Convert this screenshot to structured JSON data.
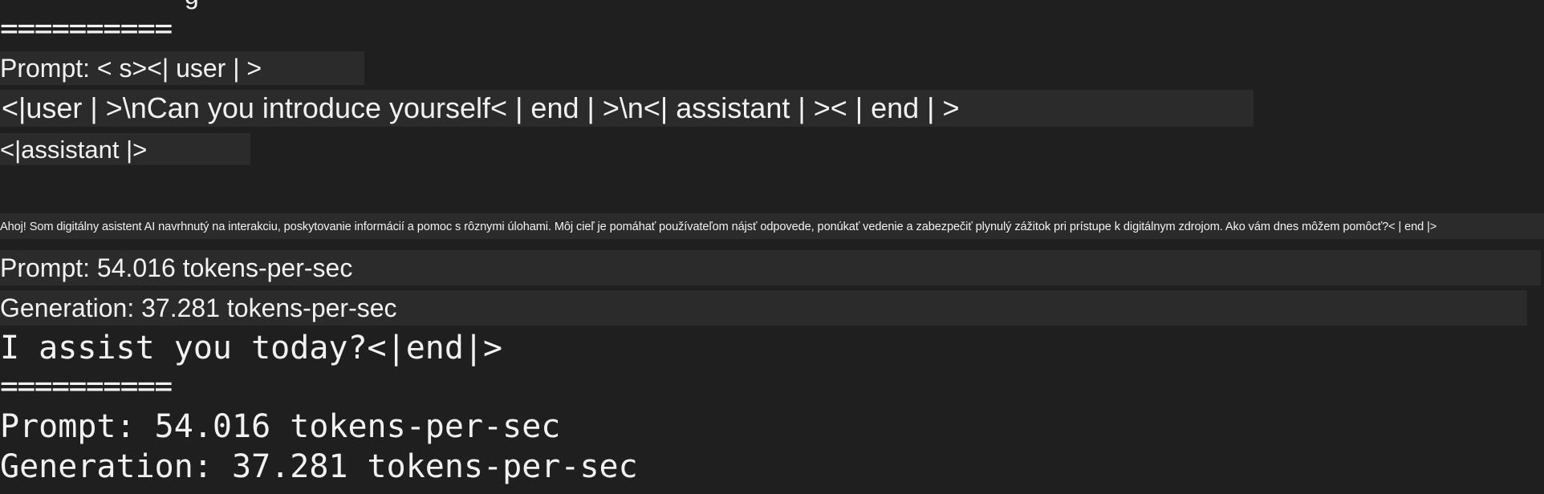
{
  "terminal": {
    "top_partial_text": "g",
    "separator_top": "==========",
    "overlay": {
      "prompt_header": "Prompt: < s><| user | >",
      "prompt_body": "<|user | >\\nCan you introduce yourself< | end | >\\n<| assistant | >< | end | >",
      "assistant_tag": "<|assistant |>",
      "response_sk": "Ahoj! Som digitálny asistent AI navrhnutý na interakciu, poskytovanie informácií a pomoc s rôznymi úlohami. Môj cieľ je pomáhať používateľom nájsť odpovede, ponúkať vedenie a zabezpečiť plynulý zážitok pri prístupe k digitálnym zdrojom. Ako vám dnes môžem pomôcť?< | end |>",
      "prompt_rate": "Prompt: 54.016 tokens-per-sec",
      "generation_rate": "Generation: 37.281 tokens-per-sec"
    },
    "mono_line_reply": "I assist you today?<|end|>",
    "separator_bottom": "==========",
    "mono_prompt_rate": "Prompt: 54.016 tokens-per-sec",
    "mono_generation_rate": "Generation: 37.281 tokens-per-sec"
  }
}
